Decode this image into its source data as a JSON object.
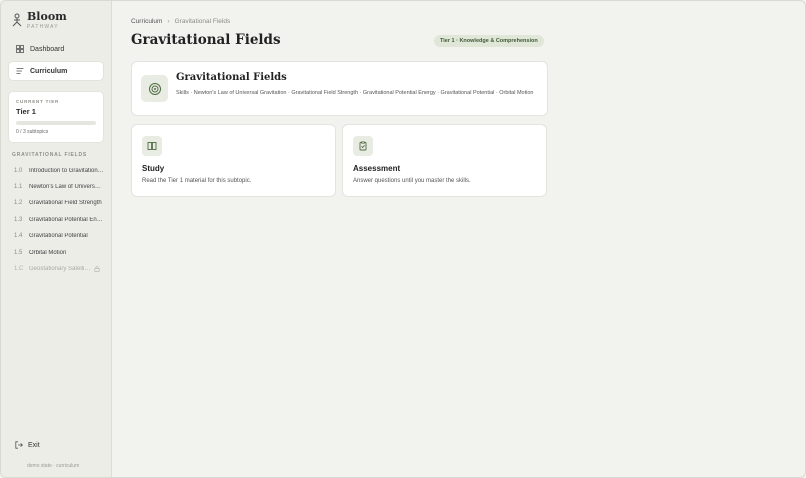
{
  "brand": {
    "name": "Bloom",
    "subtitle": "PATHWAY",
    "icon": "person-icon"
  },
  "nav": {
    "items": [
      {
        "label": "Dashboard",
        "icon": "grid-icon",
        "active": false
      },
      {
        "label": "Curriculum",
        "icon": "list-icon",
        "active": true
      }
    ]
  },
  "tier_card": {
    "label": "CURRENT TIER",
    "tier": "Tier 1",
    "progress": 0,
    "progress_text": "0 / 3 subtopics"
  },
  "topics": {
    "section_label": "GRAVITATIONAL FIELDS",
    "items": [
      {
        "num": "1.0",
        "title": "Introduction to Gravitational Fields",
        "locked": false
      },
      {
        "num": "1.1",
        "title": "Newton's Law of Universal Gravitation",
        "locked": false
      },
      {
        "num": "1.2",
        "title": "Gravitational Field Strength",
        "locked": false
      },
      {
        "num": "1.3",
        "title": "Gravitational Potential Energy",
        "locked": false
      },
      {
        "num": "1.4",
        "title": "Gravitational Potential",
        "locked": false
      },
      {
        "num": "1.5",
        "title": "Orbital Motion",
        "locked": false
      },
      {
        "num": "1.C",
        "title": "Geostationary Satellites",
        "locked": true
      }
    ]
  },
  "exit": {
    "label": "Exit",
    "icon": "exit-icon"
  },
  "footnote": "demo state · curriculum",
  "breadcrumb": {
    "root": "Curriculum",
    "separator": "›",
    "current": "Gravitational Fields"
  },
  "page_title": "Gravitational Fields",
  "tier_badge": "Tier 1 · Knowledge & Comprehension",
  "topic_card": {
    "title": "Gravitational Fields",
    "skills": "Skills · Newton's Law of Universal Gravitation · Gravitational Field Strength · Gravitational Potential Energy · Gravitational Potential · Orbital Motion",
    "icon": "target-icon"
  },
  "actions": [
    {
      "title": "Study",
      "description": "Read the Tier 1 material for this subtopic.",
      "icon": "book-icon"
    },
    {
      "title": "Assessment",
      "description": "Answer questions until you master the skills.",
      "icon": "clipboard-check-icon"
    }
  ],
  "colors": {
    "accent": "#3f5a34",
    "badge_bg": "#e0e7d8",
    "background": "#f2f3ee",
    "sidebar": "#ecede7"
  }
}
